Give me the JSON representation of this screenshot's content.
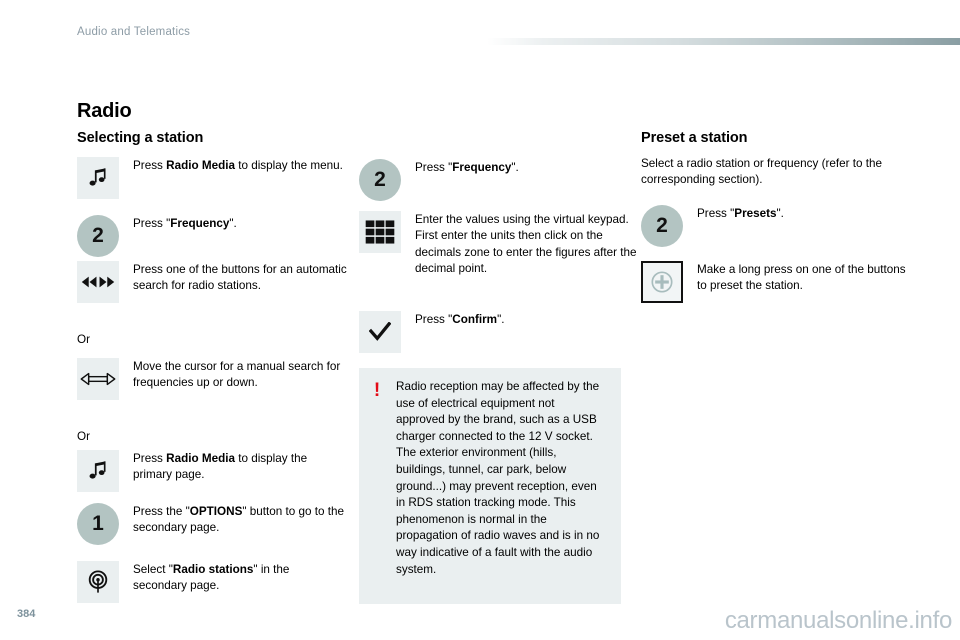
{
  "header": {
    "section_title": "Audio and Telematics"
  },
  "page": {
    "title": "Radio",
    "number": "384",
    "watermark": "carmanualsonline.info"
  },
  "left_column": {
    "heading": "Selecting a station",
    "or_1": "Or",
    "or_2": "Or",
    "steps": [
      {
        "icon": "music-note-icon",
        "text_pre": "Press ",
        "text_bold": "Radio Media",
        "text_post": " to display the menu."
      },
      {
        "icon": "step-number-2-icon",
        "badge": "2",
        "text_pre": "Press \"",
        "text_bold": "Frequency",
        "text_post": "\"."
      },
      {
        "icon": "double-arrow-seek-icon",
        "text_pre": "Press one of the buttons for an automatic search for radio stations.",
        "text_bold": "",
        "text_post": ""
      },
      {
        "icon": "horizontal-cursor-icon",
        "text_pre": "Move the cursor for a manual search for frequencies up or down.",
        "text_bold": "",
        "text_post": ""
      },
      {
        "icon": "music-note-icon",
        "text_pre": "Press ",
        "text_bold": "Radio Media",
        "text_post": " to display the primary page."
      },
      {
        "icon": "step-number-1-icon",
        "badge": "1",
        "text_pre": "Press the \"",
        "text_bold": "OPTIONS",
        "text_post": "\" button to go to the secondary page."
      },
      {
        "icon": "radio-broadcast-icon",
        "text_pre": "Select \"",
        "text_bold": "Radio stations",
        "text_post": "\" in the secondary page."
      }
    ]
  },
  "middle_column": {
    "steps": [
      {
        "icon": "step-number-2-icon",
        "badge": "2",
        "text_pre": "Press \"",
        "text_bold": "Frequency",
        "text_post": "\"."
      },
      {
        "icon": "virtual-keypad-icon",
        "text_pre": "Enter the values using the virtual keypad.\nFirst enter the units then click on the decimals zone to enter the figures after the decimal point.",
        "text_bold": "",
        "text_post": ""
      },
      {
        "icon": "checkmark-icon",
        "text_pre": "Press \"",
        "text_bold": "Confirm",
        "text_post": "\"."
      }
    ],
    "warning": {
      "icon": "warning-exclamation-icon",
      "symbol": "!",
      "text": "Radio reception may be affected by the use of electrical equipment not approved by the brand, such as a USB charger connected to the 12 V socket. The exterior environment (hills, buildings, tunnel, car park, below ground...) may prevent reception, even in RDS station tracking mode. This phenomenon is normal in the propagation of radio waves and is in no way indicative of a fault with the audio system."
    }
  },
  "right_column": {
    "heading": "Preset a station",
    "intro": "Select a radio station or frequency (refer to the corresponding section).",
    "steps": [
      {
        "icon": "step-number-2-icon",
        "badge": "2",
        "text_pre": "Press \"",
        "text_bold": "Presets",
        "text_post": "\"."
      },
      {
        "icon": "preset-plus-button-icon",
        "text_pre": "Make a long press on one of the buttons to preset the station.",
        "text_bold": "",
        "text_post": ""
      }
    ]
  },
  "colors": {
    "icon_box_bg": "#eaeff0",
    "badge_bg": "#b3c4c2",
    "warning_red": "#e30b17",
    "header_text": "#8d9ca6",
    "watermark": "#b9c4cb"
  }
}
